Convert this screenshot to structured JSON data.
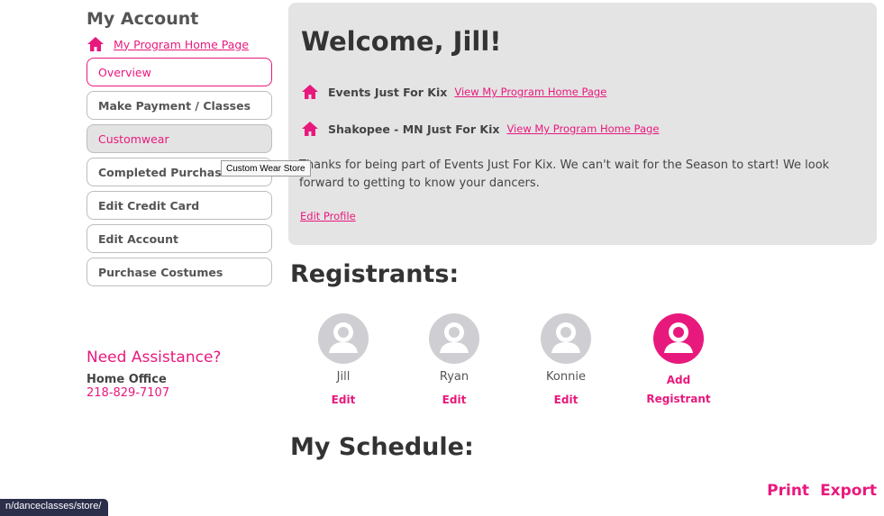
{
  "sidebar": {
    "title": "My Account",
    "home_link": "My Program Home Page",
    "items": [
      {
        "label": "Overview"
      },
      {
        "label": "Make Payment / Classes"
      },
      {
        "label": "Customwear"
      },
      {
        "label": "Completed Purchases"
      },
      {
        "label": "Edit Credit Card"
      },
      {
        "label": "Edit Account"
      },
      {
        "label": "Purchase Costumes"
      }
    ]
  },
  "tooltip": "Custom Wear Store",
  "assistance": {
    "title": "Need Assistance?",
    "office": "Home Office",
    "phone": "218-829-7107"
  },
  "welcome": {
    "title": "Welcome, Jill!",
    "programs": [
      {
        "name": "Events Just For Kix",
        "link": "View My Program Home Page"
      },
      {
        "name": "Shakopee - MN Just For Kix",
        "link": "View My Program Home Page"
      }
    ],
    "message": "Thanks for being part of Events Just For Kix. We can't wait for the Season to start! We look forward to getting to know your dancers.",
    "edit_profile": "Edit Profile"
  },
  "registrants": {
    "title": "Registrants:",
    "people": [
      {
        "name": "Jill",
        "edit": "Edit"
      },
      {
        "name": "Ryan",
        "edit": "Edit"
      },
      {
        "name": "Konnie",
        "edit": "Edit"
      }
    ],
    "add_label_1": "Add",
    "add_label_2": "Registrant"
  },
  "schedule": {
    "title": "My Schedule:",
    "print": "Print",
    "export": "Export"
  },
  "status_url": "n/danceclasses/store/",
  "colors": {
    "accent": "#e8197d",
    "panel": "#e4e4e4",
    "avatar_grey": "#cfcfd3"
  },
  "icons": [
    "home-icon",
    "user-avatar-icon",
    "add-user-icon"
  ]
}
